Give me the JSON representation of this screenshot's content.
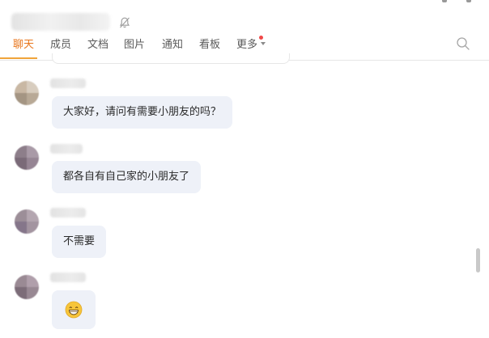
{
  "header": {
    "tabs": [
      {
        "label": "聊天",
        "active": true
      },
      {
        "label": "成员",
        "active": false
      },
      {
        "label": "文档",
        "active": false
      },
      {
        "label": "图片",
        "active": false
      },
      {
        "label": "通知",
        "active": false
      },
      {
        "label": "看板",
        "active": false
      },
      {
        "label": "更多",
        "active": false,
        "has_badge_dot": true
      }
    ],
    "icons": [
      "mute-icon",
      "search-icon"
    ]
  },
  "messages": [
    {
      "text": "大家好，请问有需要小朋友的吗？"
    },
    {
      "text": "都各自有自己家的小朋友了"
    },
    {
      "text": "不需要"
    },
    {
      "text": "",
      "emoji": "grinning-face"
    }
  ],
  "colors": {
    "accent": "#e8761c",
    "tab_underline": "#f0a43a",
    "bubble": "#eef1f8",
    "badge_dot": "#f04848"
  }
}
